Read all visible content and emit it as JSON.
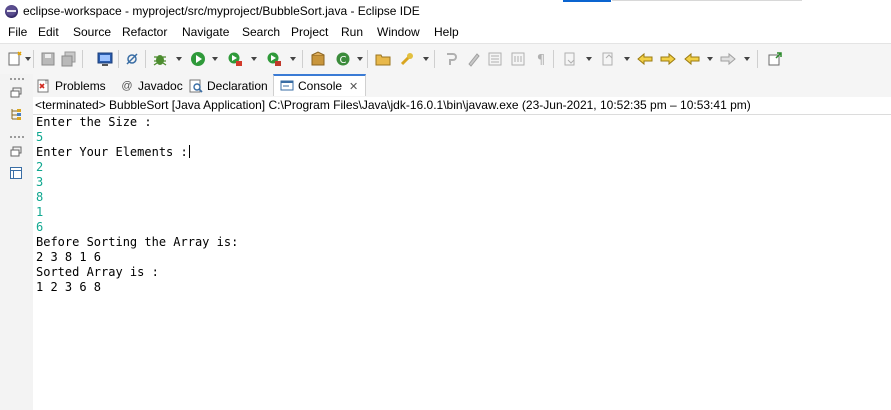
{
  "window": {
    "title": "eclipse-workspace - myproject/src/myproject/BubbleSort.java - Eclipse IDE"
  },
  "menu": [
    "File",
    "Edit",
    "Source",
    "Refactor",
    "Navigate",
    "Search",
    "Project",
    "Run",
    "Window",
    "Help"
  ],
  "toolbar_icons": [
    "new-icon",
    "save-icon",
    "save-all-icon",
    "terminal-icon",
    "skip-breakpoints-icon",
    "debug-icon",
    "run-icon",
    "coverage-icon",
    "external-tools-icon",
    "new-package-icon",
    "new-class-icon",
    "open-type-icon",
    "search-icon",
    "annotation-icon",
    "highlight-icon",
    "block-selection-icon",
    "show-whitespace-icon",
    "pilcrow-icon",
    "next-annotation-icon",
    "prev-annotation-icon",
    "last-edit-icon",
    "back-icon",
    "forward-icon",
    "pin-editor-icon"
  ],
  "tabs": [
    {
      "label": "Problems",
      "icon": "problems-icon"
    },
    {
      "label": "Javadoc",
      "icon": "at-icon"
    },
    {
      "label": "Declaration",
      "icon": "declaration-icon"
    },
    {
      "label": "Console",
      "icon": "console-icon",
      "active": true
    }
  ],
  "console": {
    "status": "<terminated> BubbleSort [Java Application] C:\\Program Files\\Java\\jdk-16.0.1\\bin\\javaw.exe  (23-Jun-2021, 10:52:35 pm – 10:53:41 pm)",
    "lines": [
      {
        "text": "Enter the Size :",
        "kind": "out"
      },
      {
        "text": "5",
        "kind": "in"
      },
      {
        "text": "Enter Your Elements :",
        "kind": "out"
      },
      {
        "text": "2",
        "kind": "in"
      },
      {
        "text": "3",
        "kind": "in"
      },
      {
        "text": "8",
        "kind": "in"
      },
      {
        "text": "1",
        "kind": "in"
      },
      {
        "text": "6",
        "kind": "in"
      },
      {
        "text": "Before Sorting the Array is:",
        "kind": "out"
      },
      {
        "text": "2 3 8 1 6",
        "kind": "out"
      },
      {
        "text": "Sorted Array is :",
        "kind": "out"
      },
      {
        "text": "1 2 3 6 8",
        "kind": "out"
      }
    ]
  },
  "colors": {
    "input_text": "#10a890",
    "active_tab_accent": "#3a7bd5"
  }
}
